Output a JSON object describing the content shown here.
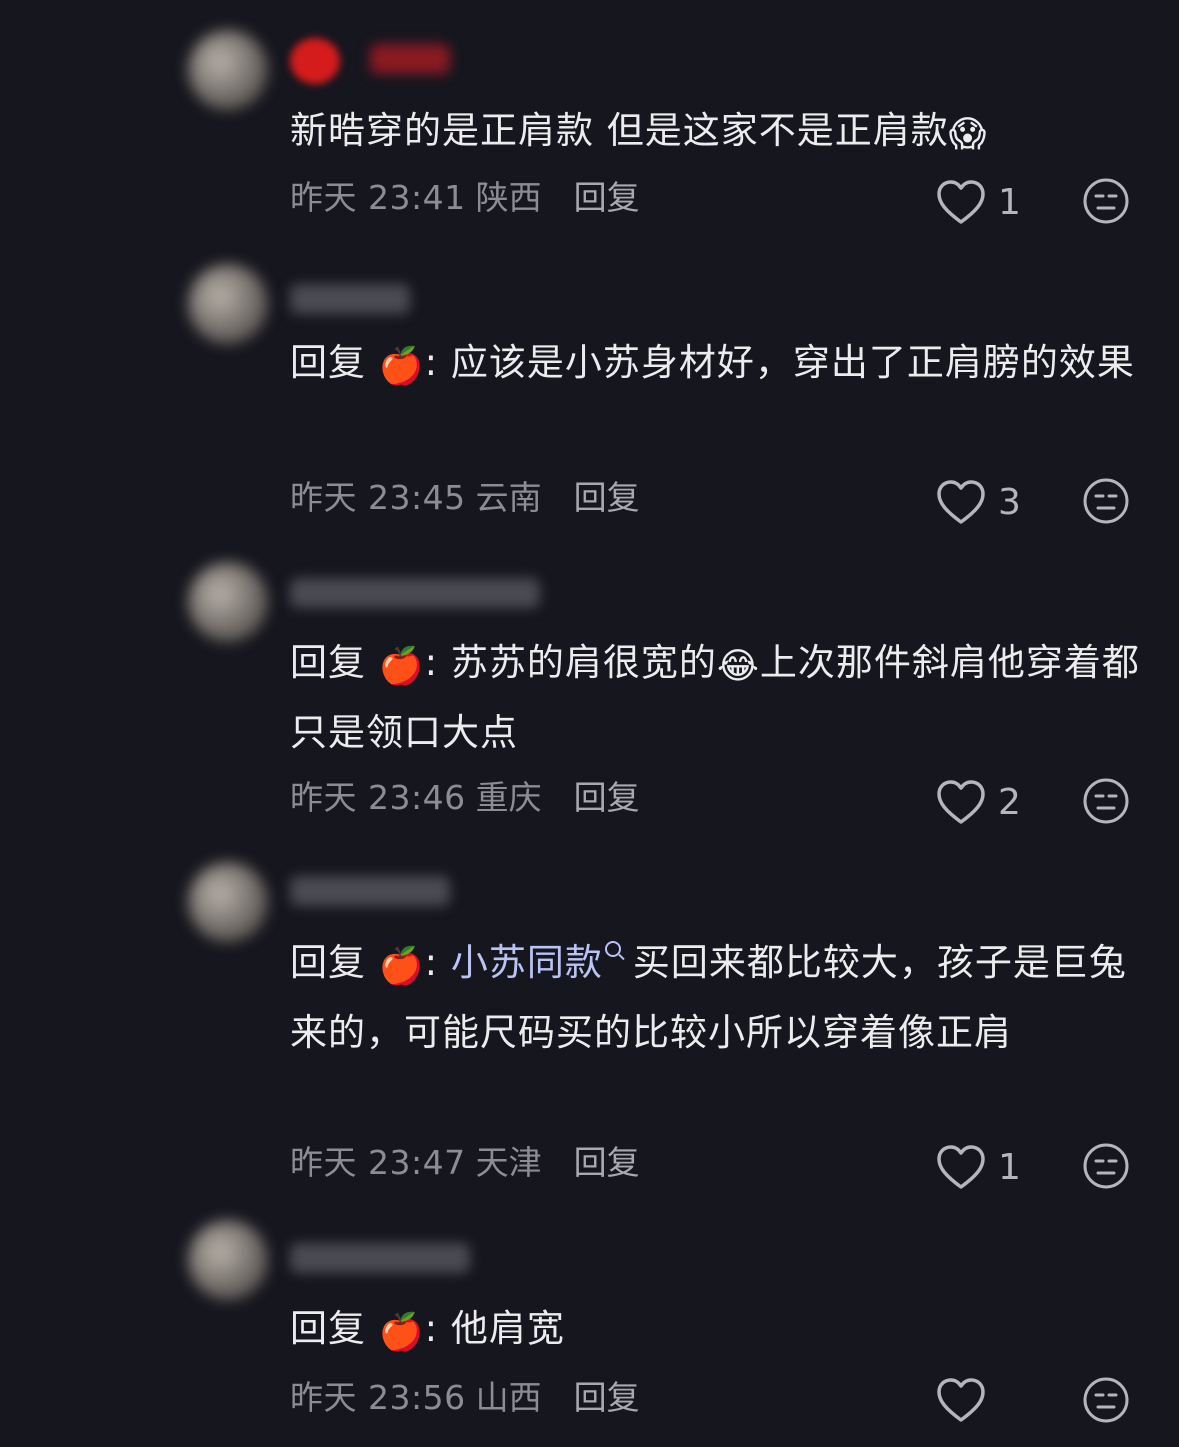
{
  "comments": [
    {
      "reply_prefix": "",
      "mention_emoji": "",
      "text": "新晧穿的是正肩款 但是这家不是正肩款",
      "trailing_emoji": "😱",
      "time": "昨天 23:41",
      "location": "陕西",
      "reply_label": "回复",
      "likes": "1"
    },
    {
      "reply_prefix": "回复 ",
      "mention_emoji": "🍎",
      "text": ": 应该是小苏身材好，穿出了正肩膀的效果",
      "time": "昨天 23:45",
      "location": "云南",
      "reply_label": "回复",
      "likes": "3"
    },
    {
      "reply_prefix": "回复 ",
      "mention_emoji": "🍎",
      "text_a": ": 苏苏的肩很宽的",
      "inline_emoji": "😂",
      "text_b": "上次那件斜肩他穿着都只是领口大点",
      "time": "昨天 23:46",
      "location": "重庆",
      "reply_label": "回复",
      "likes": "2"
    },
    {
      "reply_prefix": "回复 ",
      "mention_emoji": "🍎",
      "colon": ": ",
      "link_text": "小苏同款",
      "text": "买回来都比较大，孩子是巨兔来的，可能尺码买的比较小所以穿着像正肩",
      "time": "昨天 23:47",
      "location": "天津",
      "reply_label": "回复",
      "likes": "1"
    },
    {
      "reply_prefix": "回复 ",
      "mention_emoji": "🍎",
      "text": ": 他肩宽",
      "time": "昨天 23:56",
      "location": "山西",
      "reply_label": "回复",
      "likes": ""
    }
  ],
  "icons": {
    "like": "heart-outline-icon",
    "dislike": "unhappy-face-icon"
  },
  "colors": {
    "background": "#16161e",
    "text": "#ececef",
    "meta": "#8c8c94",
    "link": "#b9c4f5"
  }
}
